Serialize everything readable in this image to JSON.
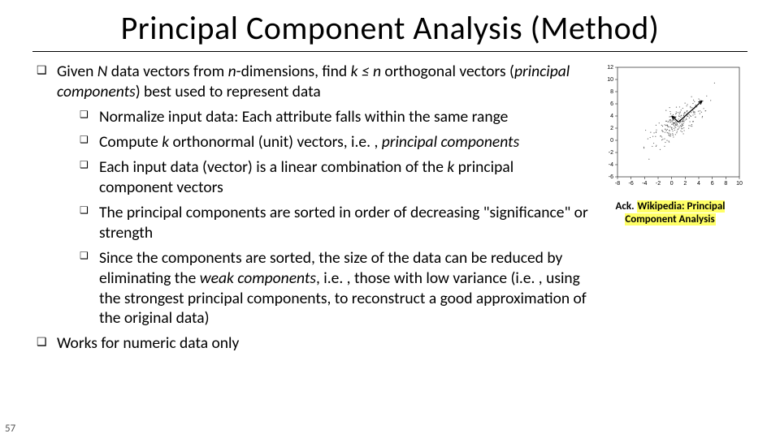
{
  "title": "Principal Component Analysis (Method)",
  "bullets": {
    "b1_pre": "Given ",
    "b1_N": "N",
    "b1_mid1": " data vectors from ",
    "b1_n": "n",
    "b1_mid2": "-dimensions, find ",
    "b1_k": "k ≤ n",
    "b1_mid3": " orthogonal vectors (",
    "b1_pc": "principal components",
    "b1_post": ") best used to represent data",
    "sub1": "Normalize input data: Each attribute falls within the same range",
    "sub2_pre": "Compute ",
    "sub2_k": "k",
    "sub2_mid": " orthonormal (unit) vectors, i.e. , ",
    "sub2_pc": "principal components",
    "sub3_pre": "Each input data (vector) is a linear combination of the ",
    "sub3_k": "k",
    "sub3_post": " principal component vectors",
    "sub4": "The principal components are sorted in order of decreasing \"significance\" or strength",
    "sub5_pre": "Since the components are sorted, the size of the data can be reduced by eliminating the ",
    "sub5_weak": "weak components",
    "sub5_post": ", i.e. , those with low variance (i.e. , using the strongest principal components, to reconstruct a good approximation of the original data)",
    "b2": "Works for numeric data only"
  },
  "ack_pre": "Ack.  ",
  "ack_link": "Wikipedia: Principal Component Analysis",
  "page": "57",
  "chart_data": {
    "type": "scatter",
    "description": "PCA scatter plot with two arrows along principal component directions",
    "xlim": [
      -8,
      10
    ],
    "ylim": [
      -6,
      12
    ],
    "xticks": [
      -8,
      -6,
      -4,
      -2,
      0,
      2,
      4,
      6,
      8,
      10
    ],
    "yticks": [
      -6,
      -4,
      -2,
      0,
      2,
      4,
      6,
      8,
      10,
      12
    ],
    "cluster_center": [
      1,
      3
    ],
    "pc1_vector": [
      3.5,
      3.5
    ],
    "pc2_vector": [
      -1.0,
      1.0
    ],
    "approx_points": 250
  }
}
